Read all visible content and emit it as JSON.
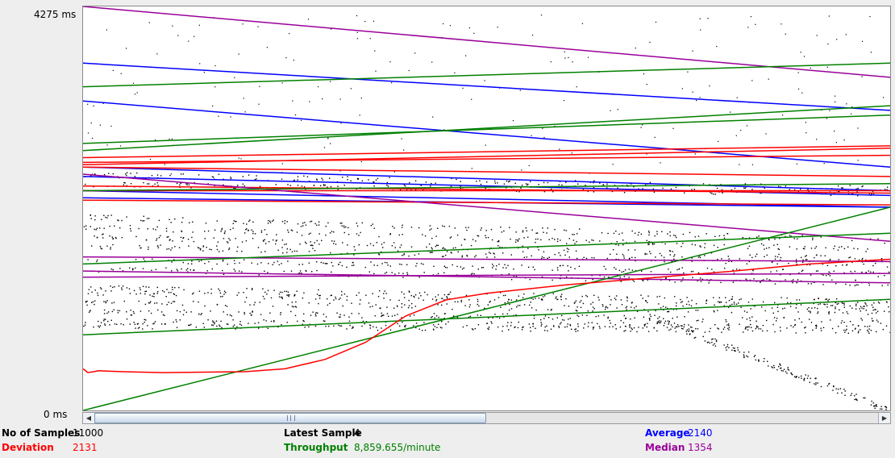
{
  "axis": {
    "y_max_label": "4275  ms",
    "y_min_label": "0  ms"
  },
  "stats": {
    "samples_label": "No of Samples",
    "samples_value": "11000",
    "latest_label": "Latest Sample",
    "latest_value": "4",
    "average_label": "Average",
    "average_value": "2140",
    "deviation_label": "Deviation",
    "deviation_value": "2131",
    "throughput_label": "Throughput",
    "throughput_value": "8,859.655/minute",
    "median_label": "Median",
    "median_value": "1354"
  },
  "colors": {
    "data": "#000000",
    "average": "#0000ff",
    "deviation": "#ff0000",
    "throughput": "#008000",
    "median": "#990099",
    "background": "#eeeeee"
  },
  "chart_data": {
    "type": "line",
    "ylim": [
      0,
      4275
    ],
    "y_unit": "ms",
    "series": [
      {
        "name": "Average",
        "lines": [
          [
            3675,
            3175
          ],
          [
            3275,
            2575
          ],
          [
            2575,
            2325
          ],
          [
            2475,
            2275
          ],
          [
            2325,
            2150
          ],
          [
            2250,
            2150
          ]
        ]
      },
      {
        "name": "Deviation",
        "lines": [
          [
            2225,
            2175
          ],
          [
            2375,
            2300
          ],
          [
            2675,
            2800
          ],
          [
            2600,
            2775
          ],
          [
            2575,
            2475
          ],
          [
            2625,
            2700
          ],
          [
            2325,
            2325
          ]
        ]
      },
      {
        "name": "Median",
        "lines": [
          [
            4275,
            3525
          ],
          [
            2500,
            1790
          ],
          [
            1625,
            1575
          ],
          [
            1475,
            1350
          ],
          [
            1410,
            1450
          ]
        ]
      },
      {
        "name": "Throughput",
        "lines": [
          [
            3425,
            3675
          ],
          [
            2825,
            3125
          ],
          [
            2750,
            3225
          ],
          [
            2325,
            2400
          ],
          [
            1550,
            1875
          ],
          [
            800,
            1175
          ],
          [
            0,
            2150
          ]
        ]
      },
      {
        "name": "Deviation",
        "curve": [
          [
            0,
            440
          ],
          [
            6,
            400
          ],
          [
            20,
            420
          ],
          [
            50,
            410
          ],
          [
            100,
            400
          ],
          [
            200,
            410
          ],
          [
            250,
            440
          ],
          [
            300,
            540
          ],
          [
            350,
            720
          ],
          [
            400,
            1000
          ],
          [
            450,
            1170
          ],
          [
            500,
            1240
          ],
          [
            600,
            1330
          ],
          [
            700,
            1400
          ],
          [
            800,
            1470
          ],
          [
            900,
            1550
          ],
          [
            1000,
            1600
          ]
        ]
      }
    ]
  }
}
